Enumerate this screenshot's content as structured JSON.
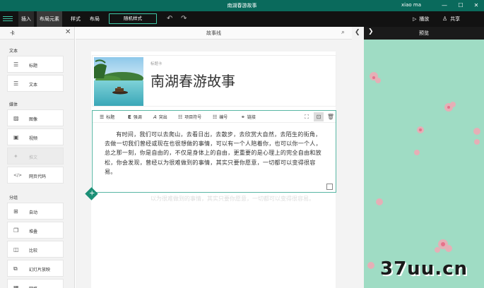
{
  "window": {
    "title": "南湖春游故事",
    "user": "xiao ma",
    "controls": [
      "—",
      "☐",
      "✕"
    ]
  },
  "ribbon": {
    "tabs": [
      {
        "label": "插入",
        "state": "active"
      },
      {
        "label": "布局元素",
        "state": "selected"
      },
      {
        "label": "样式",
        "state": ""
      },
      {
        "label": "布局",
        "state": ""
      }
    ],
    "random_style": "随机样式",
    "play": "播放",
    "share": "共享",
    "accent": "#3ec9a7"
  },
  "left_panel": {
    "title": "卡",
    "sections": {
      "text": "文本",
      "media": "媒体",
      "group": "分组"
    },
    "items": {
      "heading": "标题",
      "text": "文本",
      "image": "图像",
      "video": "视频",
      "tweet": "推文",
      "embed": "网页代码",
      "auto": "自动",
      "stack": "堆叠",
      "compare": "比较",
      "slideshow": "幻灯片放映",
      "grid": "网格"
    }
  },
  "center": {
    "title": "故事线",
    "title_card": {
      "tag": "标题卡",
      "title": "南湖春游故事"
    },
    "toolbar": {
      "heading": "标题",
      "emphasis": "强调",
      "accent": "突出",
      "bullets": "项目符号",
      "numbering": "编号",
      "link": "链接"
    },
    "body": "有时间，我们可以去爬山，去看日出，去散步，去欣赏大自然，去陌生的街角，去做一切我们曾经或现在也很想做的事情，可以有一个人陪着你，也可以你一个人，总之那一刻，你是自由的，不仅是身体上的自由，更重要的是心理上的完全自由和放松，你会发现，曾经以为很难做到的事情，其实只要你愿意，一切都可以变得很容易。",
    "ghost": "以为很难做到的事情，其实只要你愿意，一切都可以变得很容易。"
  },
  "preview": {
    "title": "预览",
    "background": "#9fdcc4"
  },
  "watermark": "37uu.cn"
}
